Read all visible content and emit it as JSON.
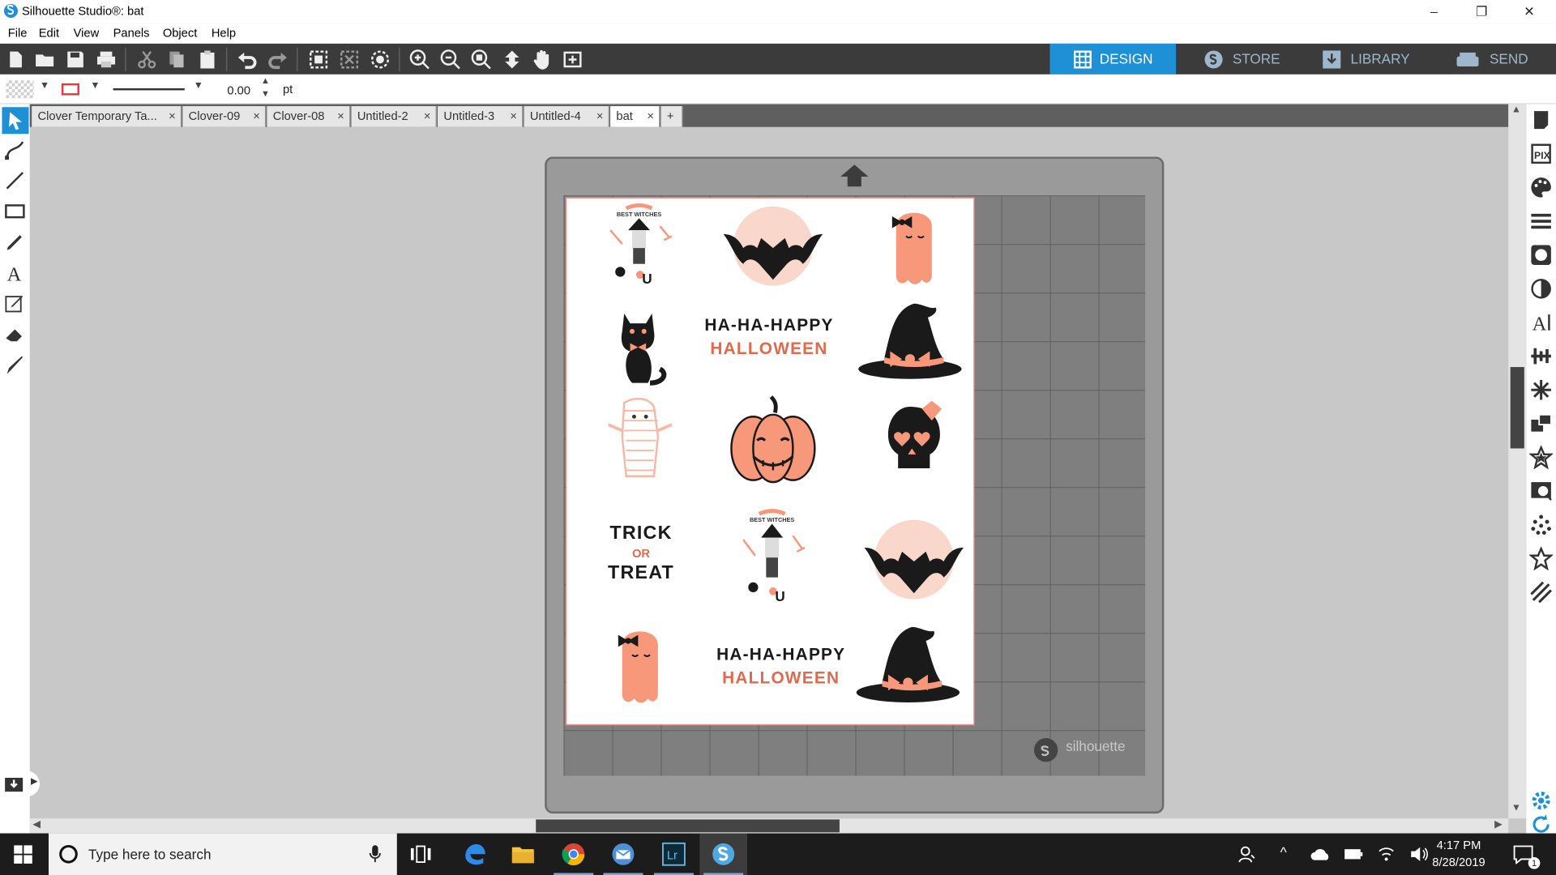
{
  "window": {
    "title": "Silhouette Studio®: bat"
  },
  "menu": [
    "File",
    "Edit",
    "View",
    "Panels",
    "Object",
    "Help"
  ],
  "nav_tabs": [
    {
      "label": "DESIGN",
      "active": true
    },
    {
      "label": "STORE",
      "active": false
    },
    {
      "label": "LIBRARY",
      "active": false
    },
    {
      "label": "SEND",
      "active": false
    }
  ],
  "props": {
    "line_width": "0.00",
    "unit": "pt"
  },
  "doc_tabs": [
    {
      "label": "Clover Temporary Ta...",
      "active": false
    },
    {
      "label": "Clover-09",
      "active": false
    },
    {
      "label": "Clover-08",
      "active": false
    },
    {
      "label": "Untitled-2",
      "active": false
    },
    {
      "label": "Untitled-3",
      "active": false
    },
    {
      "label": "Untitled-4",
      "active": false
    },
    {
      "label": "bat",
      "active": true
    }
  ],
  "tab_close_glyph": "×",
  "tab_add_glyph": "+",
  "canvas": {
    "brand": "silhouette",
    "stickers": {
      "witch_text": "BEST WITCHES",
      "happy_line1": "HA-HA-HAPPY",
      "happy_line2": "HALLOWEEN",
      "trick_line1": "TRICK",
      "trick_line2": "OR",
      "trick_line3": "TREAT"
    }
  },
  "taskbar": {
    "search_placeholder": "Type here to search",
    "time": "4:17 PM",
    "date": "8/28/2019",
    "notif_count": "1"
  },
  "colors": {
    "accent": "#1e90d6",
    "salmon": "#f7987a",
    "dark": "#1a1a1a",
    "peach_bg": "#f9d7cb"
  }
}
